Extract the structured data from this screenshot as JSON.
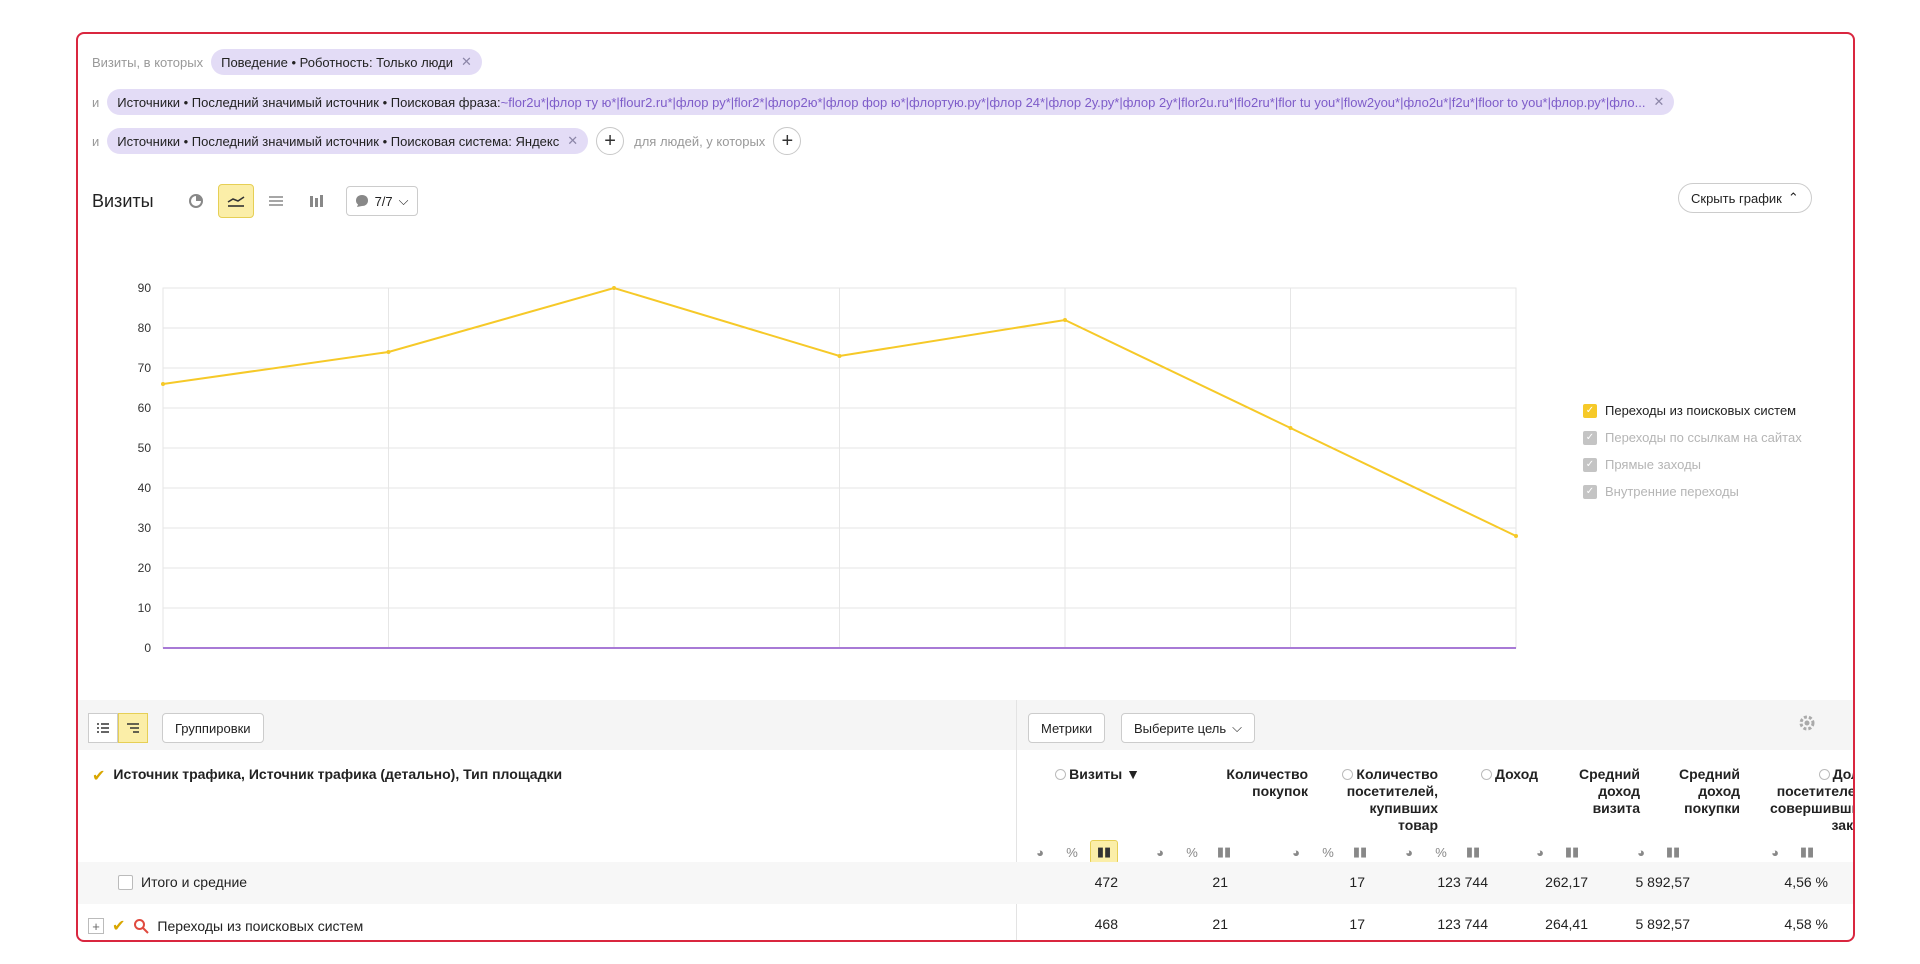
{
  "filters": {
    "lead": "Визиты, в которых",
    "and": "и",
    "chip1": "Поведение • Роботность: Только люди",
    "chip2_label": "Источники • Последний значимый источник • Поисковая фраза: ",
    "chip2_value": "~flor2u*|флор ту ю*|flour2.ru*|флор ру*|flor2*|флор2ю*|флор фор ю*|флортую.ру*|флор 24*|флор 2у.ру*|флор 2у*|flor2u.ru*|flo2ru*|flor tu you*|flow2you*|фло2u*|f2u*|floor to you*|флор.ру*|фло...",
    "chip3": "Источники • Последний значимый источник • Поисковая система: Яндекс",
    "for_people": "для людей, у которых",
    "close_glyph": "✕",
    "plus_glyph": "+"
  },
  "chart_header": {
    "title": "Визиты",
    "annotations": "7/7",
    "hide_chart": "Скрыть график"
  },
  "chart_data": {
    "type": "line",
    "ylim": [
      0,
      90
    ],
    "yticks": [
      "0",
      "10",
      "20",
      "30",
      "40",
      "50",
      "60",
      "70",
      "80",
      "90"
    ],
    "x": [
      "",
      "",
      "",
      "",
      "",
      "",
      ""
    ],
    "series": [
      {
        "name": "Переходы из поисковых систем",
        "color": "#f6c928",
        "values": [
          66,
          74,
          90,
          73,
          82,
          55,
          28
        ]
      }
    ],
    "baseline_color": "#a87ad6",
    "legend": [
      {
        "label": "Переходы из поисковых систем",
        "enabled": true
      },
      {
        "label": "Переходы по ссылкам на сайтах",
        "enabled": false
      },
      {
        "label": "Прямые заходы",
        "enabled": false
      },
      {
        "label": "Внутренние переходы",
        "enabled": false
      }
    ],
    "legend_position": "right",
    "grid": true
  },
  "toolbar": {
    "groupings": "Группировки",
    "metrics": "Метрики",
    "choose_goal": "Выберите цель"
  },
  "table": {
    "dimension_header": "Источник трафика, Источник трафика (детально), Тип площадки",
    "columns": [
      {
        "l1": "Визиты ▼",
        "l2": "",
        "l3": "",
        "l4": ""
      },
      {
        "l1": "Количество",
        "l2": "покупок",
        "l3": "",
        "l4": ""
      },
      {
        "l1": "Количество",
        "l2": "посетителей,",
        "l3": "купивших",
        "l4": "товар"
      },
      {
        "l1": "Доход",
        "l2": "",
        "l3": "",
        "l4": ""
      },
      {
        "l1": "Средний",
        "l2": "доход",
        "l3": "визита",
        "l4": ""
      },
      {
        "l1": "Средний",
        "l2": "доход",
        "l3": "покупки",
        "l4": ""
      },
      {
        "l1": "Доля",
        "l2": "посетителей,",
        "l3": "совершивших",
        "l4": "заказ"
      }
    ],
    "rows": [
      {
        "label": "Итого и средние",
        "values": [
          "472",
          "21",
          "17",
          "123 744",
          "262,17",
          "5 892,57",
          "4,56 %"
        ]
      },
      {
        "label": "Переходы из поисковых систем",
        "values": [
          "468",
          "21",
          "17",
          "123 744",
          "264,41",
          "5 892,57",
          "4,58 %"
        ]
      }
    ]
  }
}
